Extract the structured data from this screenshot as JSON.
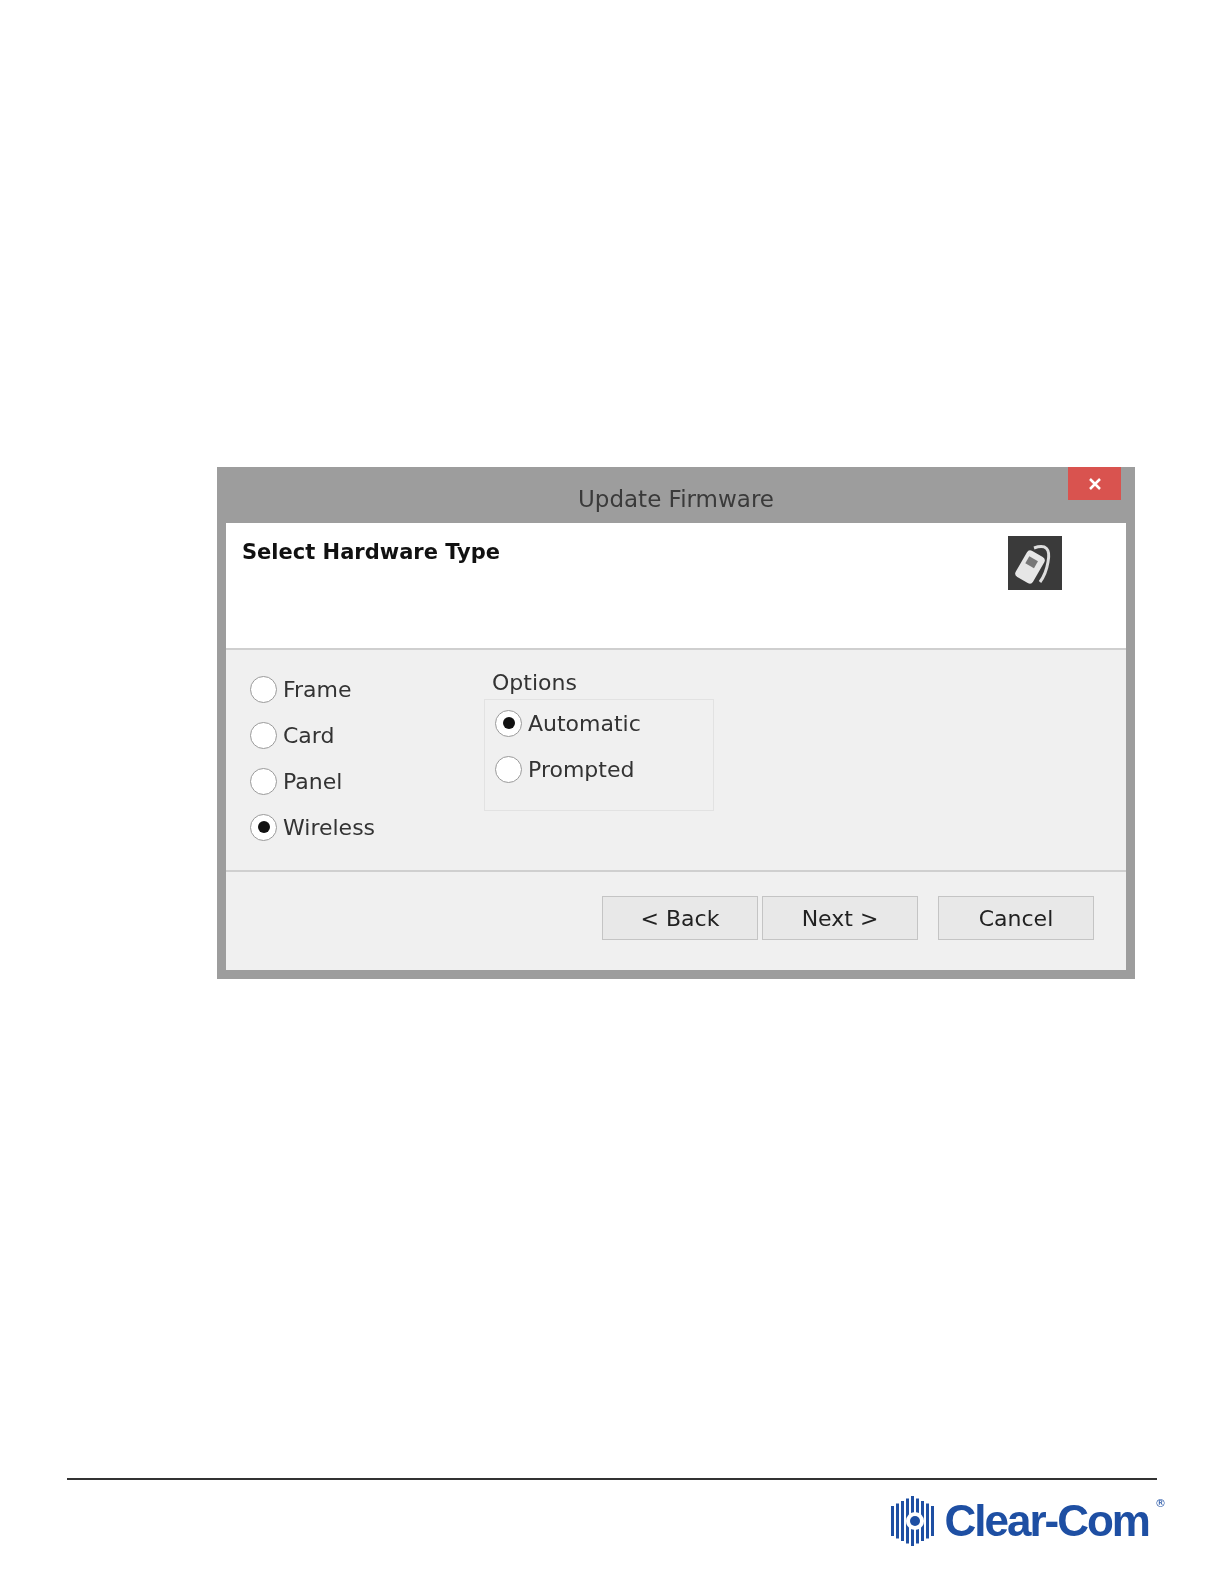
{
  "dialog": {
    "title": "Update Firmware",
    "heading": "Select Hardware Type",
    "hardware_types": [
      {
        "label": "Frame",
        "selected": false
      },
      {
        "label": "Card",
        "selected": false
      },
      {
        "label": "Panel",
        "selected": false
      },
      {
        "label": "Wireless",
        "selected": true
      }
    ],
    "options": {
      "title": "Options",
      "items": [
        {
          "label": "Automatic",
          "selected": true
        },
        {
          "label": "Prompted",
          "selected": false
        }
      ]
    },
    "buttons": [
      "< Back",
      "Next >",
      "Cancel"
    ]
  },
  "footer": {
    "logo": "Clear-Com",
    "registered": "®"
  }
}
